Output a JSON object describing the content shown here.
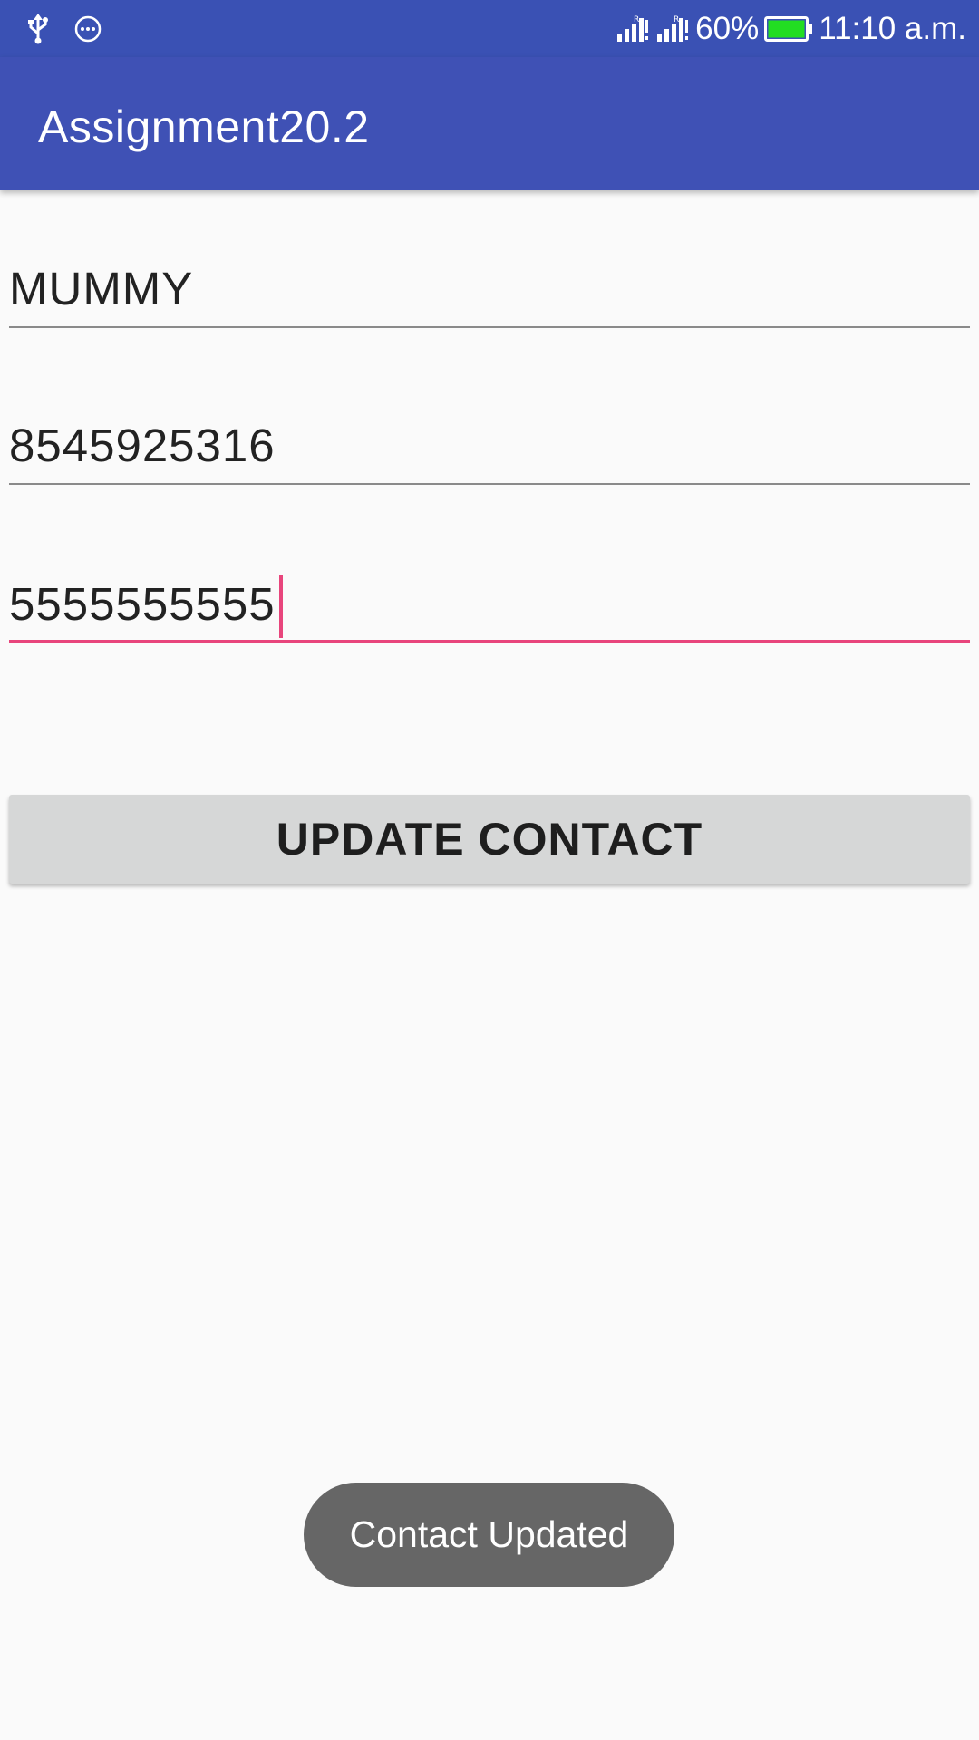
{
  "status_bar": {
    "left_icons": [
      "usb-icon",
      "more-horiz-circle-icon"
    ],
    "right_icons": [
      "signal-r-icon",
      "signal-r-icon-2",
      "battery-icon"
    ],
    "battery_percent": "60%",
    "time": "11:10 a.m.",
    "battery_fill_color": "#22dd22"
  },
  "app_bar": {
    "title": "Assignment20.2",
    "color": "#3f51b5"
  },
  "form": {
    "name_value": "MUMMY",
    "phone_value": "8545925316",
    "new_phone_value": "5555555555",
    "accent_color": "#e8457c"
  },
  "actions": {
    "update_label": "UPDATE CONTACT"
  },
  "toast": {
    "message": "Contact Updated"
  }
}
